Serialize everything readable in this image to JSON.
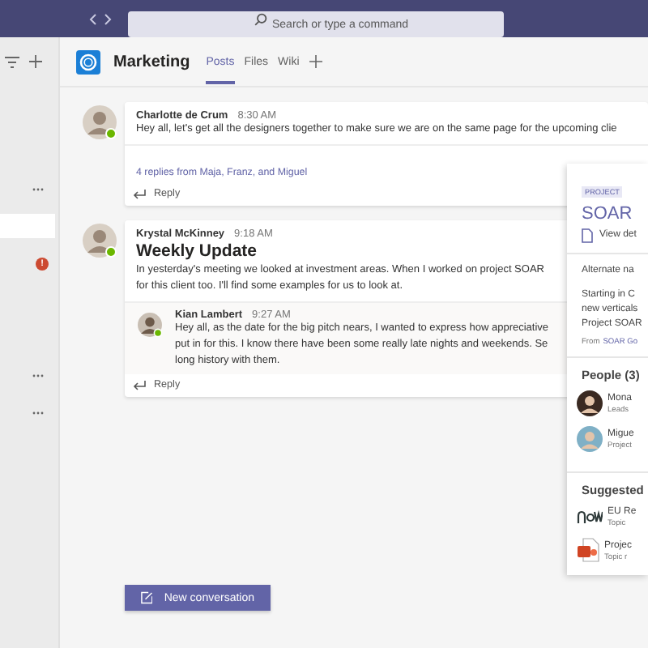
{
  "top_bar": {
    "search": {
      "placeholder": "Search or type a command"
    }
  },
  "sidebar": {
    "items": [
      {
        "kind": "more",
        "selected": false
      },
      {
        "kind": "row",
        "selected": true
      },
      {
        "kind": "badge",
        "selected": false,
        "badge": "!"
      },
      {
        "kind": "row",
        "selected": false
      },
      {
        "kind": "row",
        "selected": false
      },
      {
        "kind": "more",
        "selected": false
      },
      {
        "kind": "more",
        "selected": false
      }
    ]
  },
  "channel": {
    "team": "Marketing",
    "tabs": [
      {
        "label": "Posts",
        "selected": true
      },
      {
        "label": "Files",
        "selected": false
      },
      {
        "label": "Wiki",
        "selected": false
      }
    ]
  },
  "posts": [
    {
      "author": "Charlotte de Crum",
      "time": "8:30 AM",
      "online": true,
      "lines": [
        "Hey all, let's get all the designers together to make sure we are on the same page for the upcoming clie"
      ],
      "replies_link": "4 replies from Maja, Franz, and Miguel",
      "reply_label": "Reply"
    },
    {
      "author": "Krystal McKinney",
      "time": "9:18 AM",
      "online": true,
      "subject": "Weekly Update",
      "lines": [
        "In yesterday's meeting we looked at investment areas. When I worked on project SOAR",
        "for this client too. I'll find some examples for us to look at."
      ],
      "replies": [
        {
          "author": "Kian Lambert",
          "time": "9:27 AM",
          "online": true,
          "lines": [
            "Hey all, as the date for the big pitch nears, I wanted to express how appreciative",
            "put in for this. I know there have been some really late nights and weekends. Se",
            "long history with them."
          ]
        }
      ],
      "reply_label": "Reply"
    }
  ],
  "new_conversation": "New conversation",
  "card": {
    "tag": "PROJECT",
    "title": "SOAR",
    "view": "View det",
    "alt": "Alternate na",
    "desc": [
      "Starting in C",
      "new verticals",
      "Project SOAR"
    ],
    "from": "From",
    "from_link": "SOAR Go",
    "people_title": "People (3)",
    "people": [
      {
        "name": "Mona",
        "role": "Leads"
      },
      {
        "name": "Migue",
        "role": "Project"
      }
    ],
    "suggested_title": "Suggested",
    "suggested": [
      {
        "kind": "now",
        "title": "EU Re",
        "sub": "Topic"
      },
      {
        "kind": "slides",
        "title": "Projec",
        "sub": "Topic r"
      }
    ]
  }
}
